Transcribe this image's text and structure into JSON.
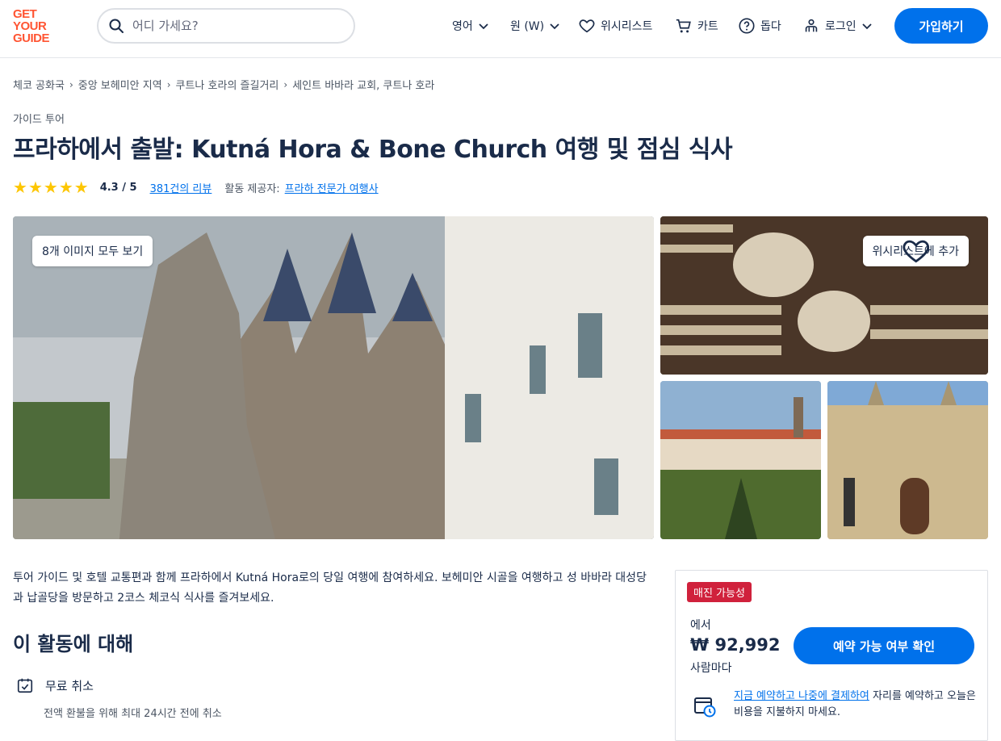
{
  "brand": {
    "logo_lines": [
      "GET",
      "YOUR",
      "GUIDE"
    ],
    "accent": "#ff5533",
    "primary": "#0071eb"
  },
  "search": {
    "placeholder": "어디 가세요?"
  },
  "nav": {
    "language": "영어",
    "currency": "원 (W)",
    "wishlist": "위시리스트",
    "cart": "카트",
    "help": "돕다",
    "login": "로그인",
    "signup": "가입하기"
  },
  "breadcrumb": [
    "체코 공화국",
    "중앙 보헤미안 지역",
    "쿠트나 호라의 즐길거리",
    "세인트 바바라 교회, 쿠트나 호라"
  ],
  "category": "가이드 투어",
  "title": "프라하에서 출발: Kutná Hora & Bone Church 여행 및 점심 식사",
  "rating": {
    "stars": 5,
    "value": "4.3 / 5",
    "reviews": "381건의 리뷰",
    "provider_label": "활동 제공자:",
    "provider": "프라하 전문가 여행사"
  },
  "gallery": {
    "view_all": "8개 이미지 모두 보기",
    "wishlist_add": "위시리스트에 추가"
  },
  "description": "투어 가이드 및 호텔 교통편과 함께 프라하에서 Kutná Hora로의 당일 여행에 참여하세요. 보헤미안 시골을 여행하고 성 바바라 대성당과 납골당을 방문하고 2코스 체코식 식사를 즐겨보세요.",
  "about": {
    "title": "이 활동에 대해",
    "feature_title": "무료 취소",
    "feature_sub": "전액 환불을 위해 최대 24시간 전에 취소"
  },
  "booking": {
    "badge": "매진 가능성",
    "from": "에서",
    "price": "₩ 92,992",
    "per": "사람마다",
    "cta": "예약 가능 여부 확인",
    "paylater_link": "지금 예약하고 나중에 결제하여",
    "paylater_text": " 자리를 예약하고 오늘은 비용을 지불하지 마세요."
  }
}
